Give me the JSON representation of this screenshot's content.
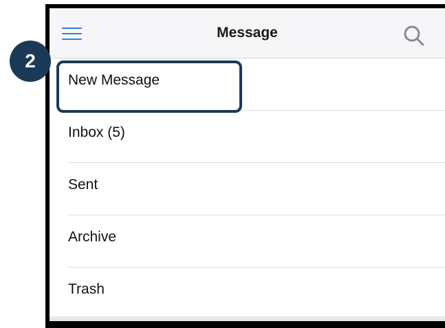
{
  "nav": {
    "title": "Message",
    "menu_icon": "hamburger-menu-icon",
    "search_icon": "search-icon",
    "accent_color": "#2f7fe0"
  },
  "menu": {
    "items": [
      {
        "label": "New Message"
      },
      {
        "label": "Inbox (5)"
      },
      {
        "label": "Sent"
      },
      {
        "label": "Archive"
      },
      {
        "label": "Trash"
      }
    ]
  },
  "annotation": {
    "step_number": "2",
    "color": "#1b3a57"
  }
}
